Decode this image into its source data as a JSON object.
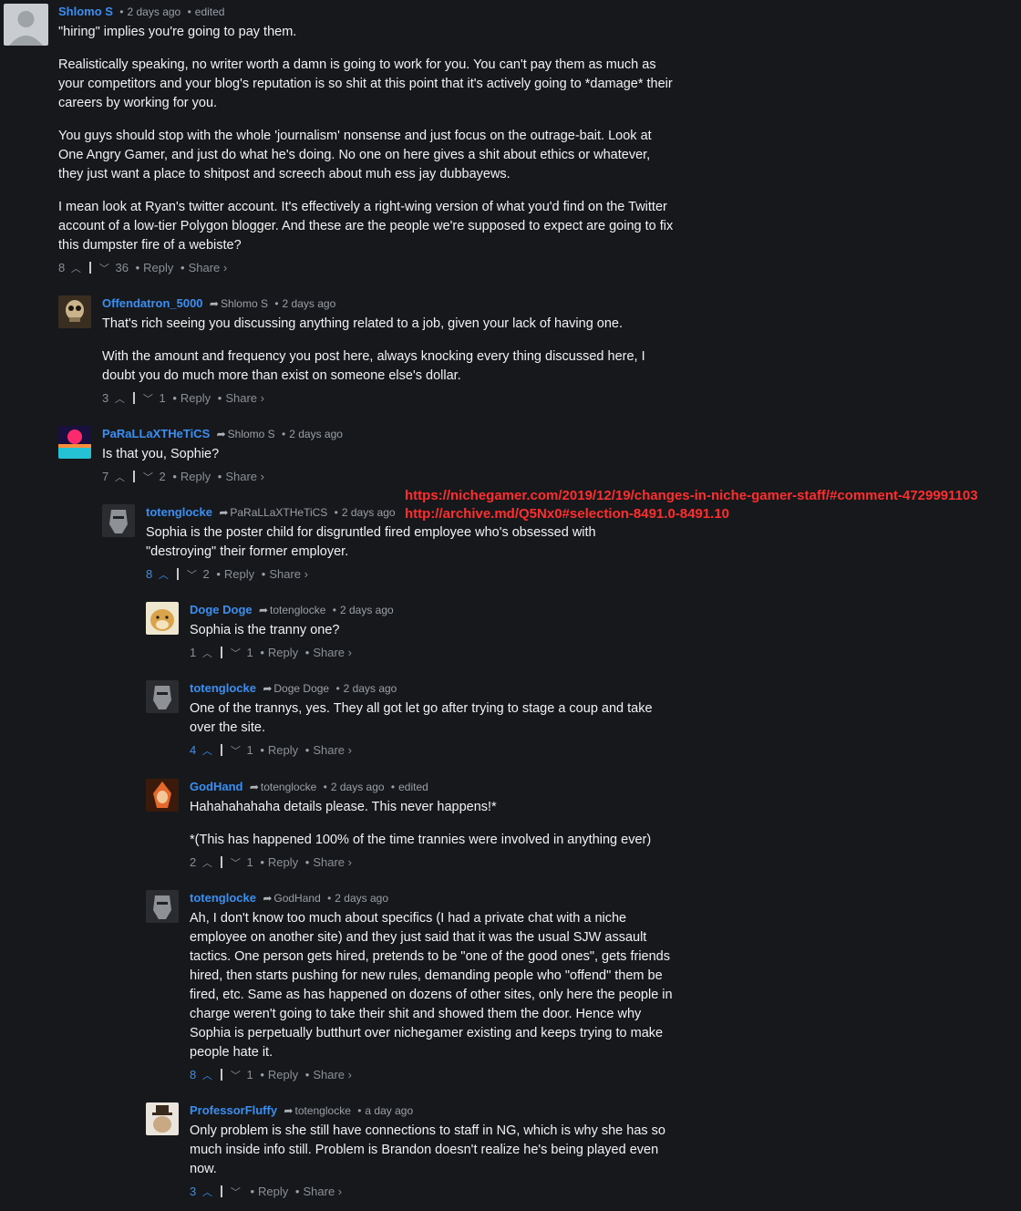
{
  "labels": {
    "reply": "Reply",
    "share": "Share ›",
    "dot": "•",
    "edited": "edited"
  },
  "annotation": {
    "line1": "https://nichegamer.com/2019/12/19/changes-in-niche-gamer-staff/#comment-4729991103",
    "line2": "http://archive.md/Q5Nx0#selection-8491.0-8491.10"
  },
  "comments": [
    {
      "author": "Shlomo S",
      "reply_to": "",
      "time": "2 days ago",
      "edited": true,
      "paragraphs": [
        "\"hiring\" implies you're going to pay them.",
        "Realistically speaking, no writer worth a damn is going to work for you. You can't pay them as much as your competitors and your blog's reputation is so shit at this point that it's actively going to *damage* their careers by working for you.",
        "You guys should stop with the whole 'journalism' nonsense and just focus on the outrage-bait. Look at One Angry Gamer, and just do what he's doing. No one on here gives a shit about ethics or whatever, they just want a place to shitpost and screech about muh ess jay dubbayews.",
        "I mean look at Ryan's twitter account. It's effectively a right-wing version of what you'd find on the Twitter account of a low-tier Polygon blogger. And these are the people we're supposed to expect are going to fix this dumpster fire of a webiste?"
      ],
      "up": "8",
      "down": "36",
      "up_highlight": false
    },
    {
      "author": "Offendatron_5000",
      "reply_to": "Shlomo S",
      "time": "2 days ago",
      "edited": false,
      "paragraphs": [
        "That's rich seeing you discussing anything related to a job, given your lack of having one.",
        "With the amount and frequency you post here, always knocking every thing discussed here, I doubt you do much more than exist on someone else's dollar."
      ],
      "up": "3",
      "down": "1",
      "up_highlight": false
    },
    {
      "author": "PaRaLLaXTHeTiCS",
      "reply_to": "Shlomo S",
      "time": "2 days ago",
      "edited": false,
      "paragraphs": [
        "Is that you, Sophie?"
      ],
      "up": "7",
      "down": "2",
      "up_highlight": false
    },
    {
      "author": "totenglocke",
      "reply_to": "PaRaLLaXTHeTiCS",
      "time": "2 days ago",
      "edited": false,
      "paragraphs": [
        "Sophia is the poster child for disgruntled fired employee who's obsessed with \"destroying\" their former employer."
      ],
      "up": "8",
      "down": "2",
      "up_highlight": true
    },
    {
      "author": "Doge Doge",
      "reply_to": "totenglocke",
      "time": "2 days ago",
      "edited": false,
      "paragraphs": [
        "Sophia is the tranny one?"
      ],
      "up": "1",
      "down": "1",
      "up_highlight": false
    },
    {
      "author": "totenglocke",
      "reply_to": "Doge Doge",
      "time": "2 days ago",
      "edited": false,
      "paragraphs": [
        "One of the trannys, yes. They all got let go after trying to stage a coup and take over the site."
      ],
      "up": "4",
      "down": "1",
      "up_highlight": true
    },
    {
      "author": "GodHand",
      "reply_to": "totenglocke",
      "time": "2 days ago",
      "edited": true,
      "paragraphs": [
        "Hahahahahaha details please. This never happens!*",
        "*(This has happened 100% of the time trannies were involved in anything ever)"
      ],
      "up": "2",
      "down": "1",
      "up_highlight": false
    },
    {
      "author": "totenglocke",
      "reply_to": "GodHand",
      "time": "2 days ago",
      "edited": false,
      "paragraphs": [
        "Ah, I don't know too much about specifics (I had a private chat with a niche employee on another site) and they just said that it was the usual SJW assault tactics. One person gets hired, pretends to be \"one of the good ones\", gets friends hired, then starts pushing for new rules, demanding people who \"offend\" them be fired, etc. Same as has happened on dozens of other sites, only here the people in charge weren't going to take their shit and showed them the door. Hence why Sophia is perpetually butthurt over nichegamer existing and keeps trying to make people hate it."
      ],
      "up": "8",
      "down": "1",
      "up_highlight": true
    },
    {
      "author": "ProfessorFluffy",
      "reply_to": "totenglocke",
      "time": "a day ago",
      "edited": false,
      "paragraphs": [
        "Only problem is she still have connections to staff in NG, which is why she has so much inside info still. Problem is Brandon doesn't realize he's being played even now."
      ],
      "up": "3",
      "down": "",
      "up_highlight": true
    }
  ]
}
